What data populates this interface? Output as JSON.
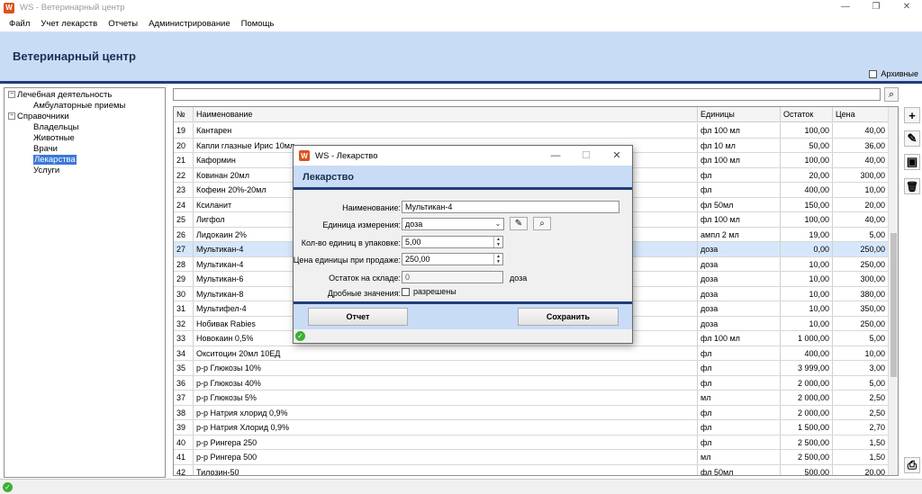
{
  "window": {
    "title": "WS - Ветеринарный центр",
    "logo": "W",
    "min": "—",
    "restore": "❐",
    "close": "✕"
  },
  "menu": [
    "Файл",
    "Учет лекарств",
    "Отчеты",
    "Администрирование",
    "Помощь"
  ],
  "header": {
    "title": "Ветеринарный центр",
    "archive_label": "Архивные"
  },
  "tree": [
    {
      "label": "Лечебная деятельность",
      "expander": "−"
    },
    {
      "label": "Амбулаторные приемы"
    },
    {
      "label": "Справочники",
      "expander": "−"
    },
    {
      "label": "Владельцы"
    },
    {
      "label": "Животные"
    },
    {
      "label": "Врачи"
    },
    {
      "label": "Лекарства"
    },
    {
      "label": "Услуги"
    }
  ],
  "grid": {
    "headers": [
      "№",
      "Наименование",
      "Единицы",
      "Остаток",
      "Цена"
    ],
    "rows": [
      [
        "19",
        "Кантарен",
        "фл 100 мл",
        "100,00",
        "40,00"
      ],
      [
        "20",
        "Капли глазные Ирис 10мл",
        "фл 10 мл",
        "50,00",
        "36,00"
      ],
      [
        "21",
        "Каформин",
        "фл 100 мл",
        "100,00",
        "40,00"
      ],
      [
        "22",
        "Ковинан 20мл",
        "фл",
        "20,00",
        "300,00"
      ],
      [
        "23",
        "Кофеин 20%-20мл",
        "фл",
        "400,00",
        "10,00"
      ],
      [
        "24",
        "Ксиланит",
        "фл 50мл",
        "150,00",
        "20,00"
      ],
      [
        "25",
        "Лигфол",
        "фл 100 мл",
        "100,00",
        "40,00"
      ],
      [
        "26",
        "Лидокаин 2%",
        "ампл 2 мл",
        "19,00",
        "5,00"
      ],
      [
        "27",
        "Мультикан-4",
        "доза",
        "0,00",
        "250,00"
      ],
      [
        "28",
        "Мультикан-4",
        "доза",
        "10,00",
        "250,00"
      ],
      [
        "29",
        "Мультикан-6",
        "доза",
        "10,00",
        "300,00"
      ],
      [
        "30",
        "Мультикан-8",
        "доза",
        "10,00",
        "380,00"
      ],
      [
        "31",
        "Мультифел-4",
        "доза",
        "10,00",
        "350,00"
      ],
      [
        "32",
        "Нобивак Rabies",
        "доза",
        "10,00",
        "250,00"
      ],
      [
        "33",
        "Новокаин 0,5%",
        "фл 100 мл",
        "1 000,00",
        "5,00"
      ],
      [
        "34",
        "Окситоцин 20мл 10ЕД",
        "фл",
        "400,00",
        "10,00"
      ],
      [
        "35",
        "р-р Глюкозы 10%",
        "фл",
        "3 999,00",
        "3,00"
      ],
      [
        "36",
        "р-р Глюкозы 40%",
        "фл",
        "2 000,00",
        "5,00"
      ],
      [
        "37",
        "р-р Глюкозы 5%",
        "мл",
        "2 000,00",
        "2,50"
      ],
      [
        "38",
        "р-р Натрия хлорид 0,9%",
        "фл",
        "2 000,00",
        "2,50"
      ],
      [
        "39",
        "р-р Натрия Хлорид 0,9%",
        "фл",
        "1 500,00",
        "2,70"
      ],
      [
        "40",
        "р-р Рингера 250",
        "фл",
        "2 500,00",
        "1,50"
      ],
      [
        "41",
        "р-р Рингера 500",
        "мл",
        "2 500,00",
        "1,50"
      ],
      [
        "42",
        "Тилозин-50",
        "фл 50мл",
        "500,00",
        "20,00"
      ]
    ],
    "selected_index": 8
  },
  "toolbar": {
    "add": "+",
    "edit": "✎",
    "archive": "▣",
    "delete": "🗑",
    "print": "⎙"
  },
  "search": {
    "icon": "⌕"
  },
  "status": {
    "ok": "✓"
  },
  "dialog": {
    "title": "WS - Лекарство",
    "logo": "W",
    "min": "—",
    "max": "☐",
    "close": "✕",
    "header": "Лекарство",
    "fields": {
      "name_label": "Наименование:",
      "name_value": "Мультикан-4",
      "unit_label": "Единица измерения:",
      "unit_value": "доза",
      "qty_label": "Кол-во единиц в упаковке:",
      "qty_value": "5,00",
      "price_label": "Цена единицы при продаже:",
      "price_value": "250,00",
      "stock_label": "Остаток на складе:",
      "stock_value": "0",
      "stock_unit": "доза",
      "fraction_label": "Дробные значения:",
      "fraction_check": "разрешены"
    },
    "buttons": {
      "report": "Отчет",
      "save": "Сохранить"
    },
    "icons": {
      "edit": "✎",
      "search": "⌕",
      "dropdown": "⌄",
      "spin_up": "▲",
      "spin_down": "▼"
    }
  }
}
